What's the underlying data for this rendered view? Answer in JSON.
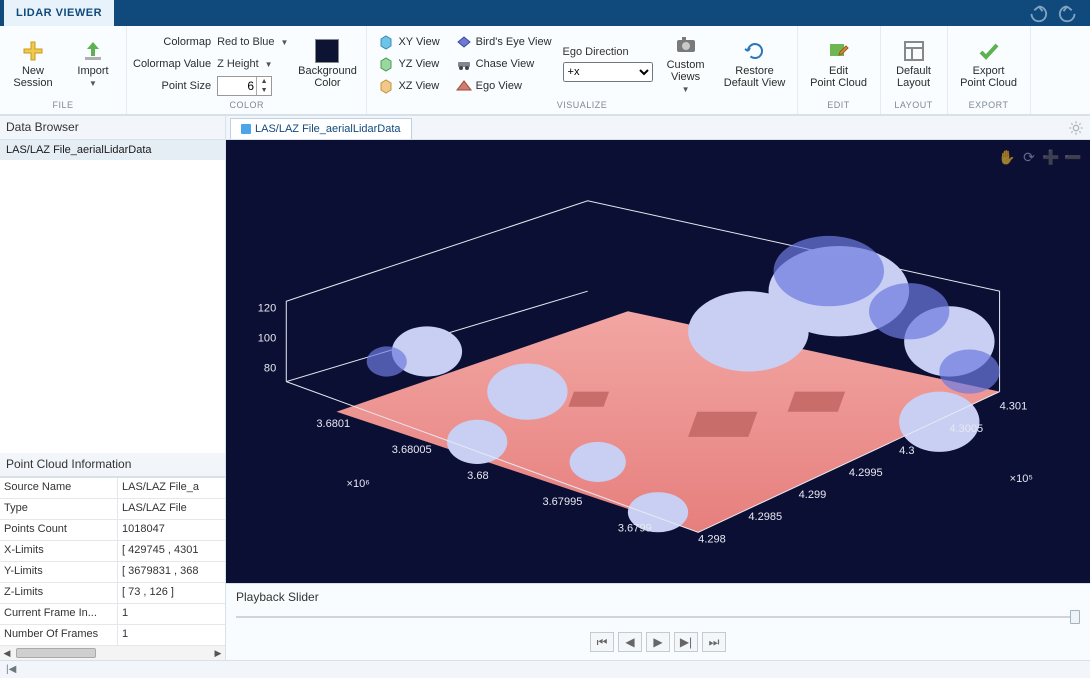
{
  "app_tab": "LIDAR VIEWER",
  "ribbon": {
    "file": {
      "label": "FILE",
      "new_session": "New\nSession",
      "import": "Import"
    },
    "color": {
      "label": "COLOR",
      "colormap_k": "Colormap",
      "colormap_v": "Red to Blue",
      "colormap_value_k": "Colormap Value",
      "colormap_value_v": "Z Height",
      "pointsize_k": "Point Size",
      "pointsize_v": "6",
      "bg_color": "Background\nColor"
    },
    "visualize": {
      "label": "VISUALIZE",
      "xy": "XY View",
      "yz": "YZ View",
      "xz": "XZ View",
      "birds": "Bird's Eye View",
      "chase": "Chase View",
      "ego": "Ego View",
      "egodir_k": "Ego Direction",
      "egodir_v": "+x",
      "custom_views": "Custom\nViews",
      "restore": "Restore\nDefault View"
    },
    "edit": {
      "label": "EDIT",
      "btn": "Edit\nPoint Cloud"
    },
    "layout": {
      "label": "LAYOUT",
      "btn": "Default\nLayout"
    },
    "export": {
      "label": "EXPORT",
      "btn": "Export\nPoint Cloud"
    }
  },
  "side": {
    "browser_title": "Data Browser",
    "item": "LAS/LAZ File_aerialLidarData",
    "info_title": "Point Cloud Information",
    "props": [
      {
        "k": "Source Name",
        "v": "LAS/LAZ File_a"
      },
      {
        "k": "Type",
        "v": "LAS/LAZ File"
      },
      {
        "k": "Points Count",
        "v": "1018047"
      },
      {
        "k": "X-Limits",
        "v": "[ 429745 , 4301"
      },
      {
        "k": "Y-Limits",
        "v": "[ 3679831 , 368"
      },
      {
        "k": "Z-Limits",
        "v": "[ 73 , 126 ]"
      },
      {
        "k": "Current Frame In...",
        "v": "1"
      },
      {
        "k": "Number Of Frames",
        "v": "1"
      }
    ]
  },
  "view": {
    "tab": "LAS/LAZ File_aerialLidarData",
    "z_ticks": [
      "120",
      "100",
      "80"
    ],
    "y_ticks": [
      "3.6801",
      "3.68005",
      "3.68",
      "3.67995",
      "3.6799"
    ],
    "y_exp": "×10⁶",
    "x_ticks": [
      "4.298",
      "4.2985",
      "4.299",
      "4.2995",
      "4.3",
      "4.3005",
      "4.301"
    ],
    "x_exp": "×10⁵"
  },
  "playback": {
    "title": "Playback Slider"
  }
}
